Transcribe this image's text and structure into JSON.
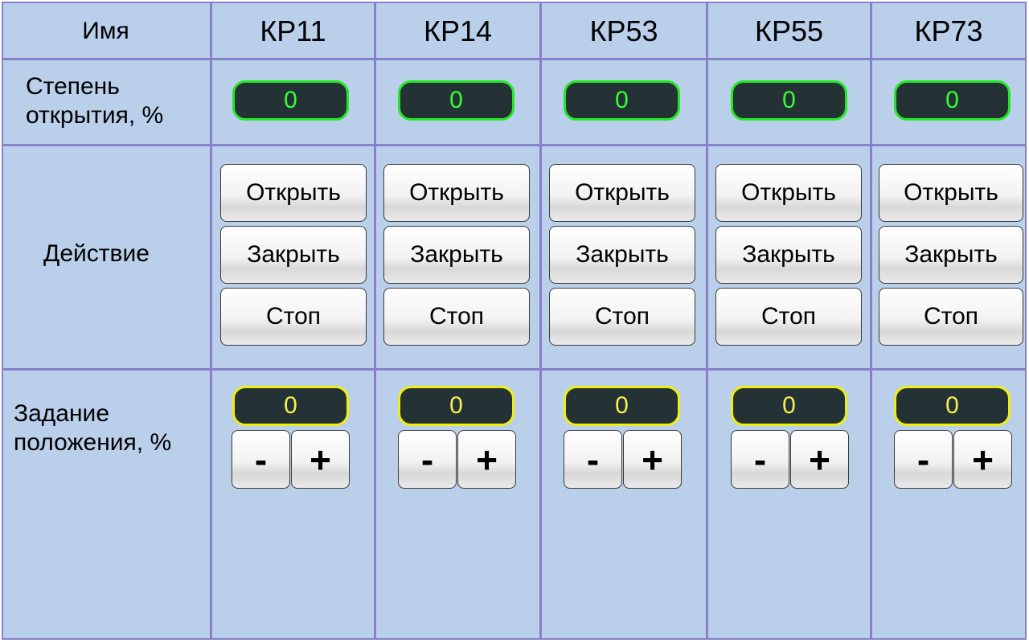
{
  "rows": {
    "name_label": "Имя",
    "opening_label_line1": "Степень",
    "opening_label_line2": "открытия, %",
    "action_label": "Действие",
    "setpoint_label_line1": "Задание",
    "setpoint_label_line2": "положения, %"
  },
  "valves": [
    {
      "name": "КР11",
      "opening": "0",
      "setpoint": "0",
      "open_label": "Открыть",
      "close_label": "Закрыть",
      "stop_label": "Стоп",
      "minus_label": "-",
      "plus_label": "+"
    },
    {
      "name": "КР14",
      "opening": "0",
      "setpoint": "0",
      "open_label": "Открыть",
      "close_label": "Закрыть",
      "stop_label": "Стоп",
      "minus_label": "-",
      "plus_label": "+"
    },
    {
      "name": "КР53",
      "opening": "0",
      "setpoint": "0",
      "open_label": "Открыть",
      "close_label": "Закрыть",
      "stop_label": "Стоп",
      "minus_label": "-",
      "plus_label": "+"
    },
    {
      "name": "КР55",
      "opening": "0",
      "setpoint": "0",
      "open_label": "Открыть",
      "close_label": "Закрыть",
      "stop_label": "Стоп",
      "minus_label": "-",
      "plus_label": "+"
    },
    {
      "name": "КР73",
      "opening": "0",
      "setpoint": "0",
      "open_label": "Открыть",
      "close_label": "Закрыть",
      "stop_label": "Стоп",
      "minus_label": "-",
      "plus_label": "+"
    }
  ],
  "colors": {
    "panel_background": "#b9cfea",
    "grid_lines": "#8880c8",
    "display_background": "#253235",
    "opening_display_border": "#22e822",
    "setpoint_display_border": "#f0ee10"
  }
}
